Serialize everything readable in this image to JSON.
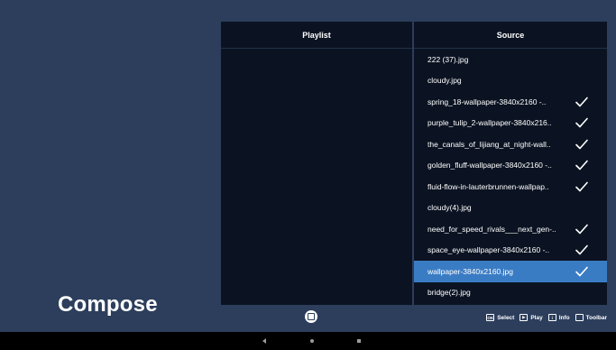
{
  "app": {
    "title": "Compose"
  },
  "playlist": {
    "header": "Playlist",
    "items": []
  },
  "source": {
    "header": "Source",
    "items": [
      {
        "name": "222 (37).jpg",
        "checked": false,
        "selected": false
      },
      {
        "name": "cloudy.jpg",
        "checked": false,
        "selected": false
      },
      {
        "name": "spring_18-wallpaper-3840x2160 -..",
        "checked": true,
        "selected": false
      },
      {
        "name": "purple_tulip_2-wallpaper-3840x216..",
        "checked": true,
        "selected": false
      },
      {
        "name": "the_canals_of_lijiang_at_night-wall..",
        "checked": true,
        "selected": false
      },
      {
        "name": "golden_fluff-wallpaper-3840x2160 -..",
        "checked": true,
        "selected": false
      },
      {
        "name": "fluid-flow-in-lauterbrunnen-wallpap..",
        "checked": true,
        "selected": false
      },
      {
        "name": "cloudy(4).jpg",
        "checked": false,
        "selected": false
      },
      {
        "name": "need_for_speed_rivals___next_gen-..",
        "checked": true,
        "selected": false
      },
      {
        "name": "space_eye-wallpaper-3840x2160 -..",
        "checked": true,
        "selected": false
      },
      {
        "name": "wallpaper-3840x2160.jpg",
        "checked": true,
        "selected": true
      },
      {
        "name": "bridge(2).jpg",
        "checked": false,
        "selected": false
      }
    ]
  },
  "footer": {
    "hints": [
      {
        "key": "OK",
        "label": "Select",
        "icon": "ok-key-icon"
      },
      {
        "key": "▶",
        "label": "Play",
        "icon": "play-key-icon"
      },
      {
        "key": "i",
        "label": "Info",
        "icon": "info-key-icon"
      },
      {
        "key": "",
        "label": "Toolbar",
        "icon": "toolbar-key-icon"
      }
    ]
  },
  "colors": {
    "background": "#2c3e5c",
    "panel": "#0b1322",
    "selected": "#3a7cc4",
    "navbar": "#000000"
  }
}
